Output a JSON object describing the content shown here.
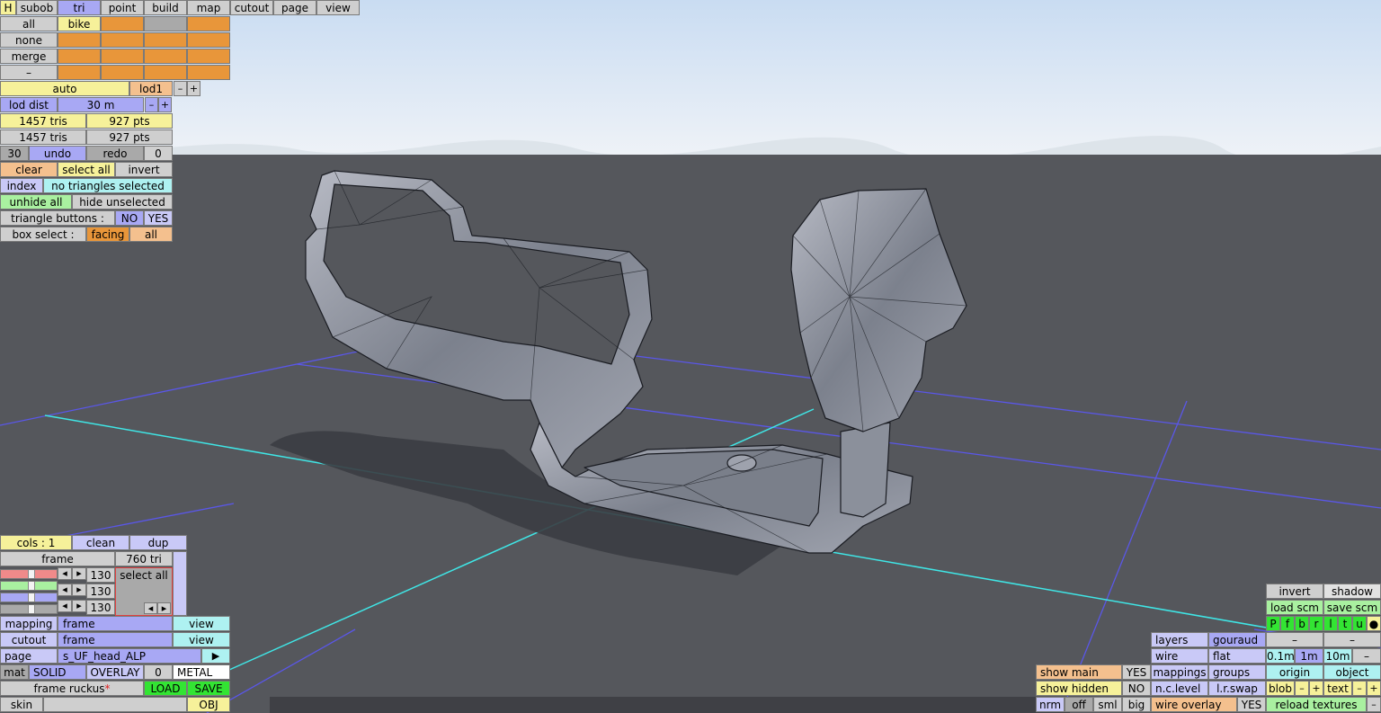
{
  "top_menu": {
    "h": "H",
    "subob": "subob",
    "tri": "tri",
    "point": "point",
    "build": "build",
    "map": "map",
    "cutout": "cutout",
    "page": "page",
    "view": "view"
  },
  "select_panel": {
    "all": "all",
    "none": "none",
    "merge": "merge",
    "dash": "–",
    "object_name": "bike"
  },
  "lod": {
    "auto": "auto",
    "lod1": "lod1",
    "minus": "–",
    "plus": "+",
    "lod_dist_label": "lod dist",
    "lod_dist_value": "30 m"
  },
  "stats": {
    "tris_selected": "1457 tris",
    "pts_selected": "927 pts",
    "tris_total": "1457 tris",
    "pts_total": "927 pts"
  },
  "history": {
    "count": "30",
    "undo": "undo",
    "redo": "redo",
    "redo_count": "0"
  },
  "selection": {
    "clear": "clear",
    "select_all": "select all",
    "invert": "invert",
    "index": "index",
    "status": "no triangles selected",
    "unhide_all": "unhide all",
    "hide_unselected": "hide unselected",
    "triangle_buttons_label": "triangle buttons :",
    "no": "NO",
    "yes": "YES",
    "box_select_label": "box select :",
    "facing": "facing",
    "all": "all"
  },
  "bottom_left": {
    "cols": "cols : 1",
    "clean": "clean",
    "dup": "dup",
    "frame": "frame",
    "frame_tri": "760 tri",
    "r_value": "130",
    "g_value": "130",
    "b_value": "130",
    "select_all": "select all",
    "mapping": "mapping",
    "mapping_value": "frame",
    "mapping_view": "view",
    "cutout": "cutout",
    "cutout_value": "frame",
    "cutout_view": "view",
    "page": "page",
    "page_value": "s_UF_head_ALP",
    "arrow": "▶",
    "mat": "mat",
    "solid": "SOLID",
    "overlay": "OVERLAY",
    "mat_num": "0",
    "metal": "METAL",
    "file_name": "frame ruckus",
    "modified_mark": "*",
    "load": "LOAD",
    "save": "SAVE",
    "skin": "skin",
    "obj": "OBJ"
  },
  "view_panel": {
    "show_main": "show main",
    "show_main_val": "YES",
    "show_hidden": "show hidden",
    "show_hidden_val": "NO",
    "nrm": "nrm",
    "off": "off",
    "sml": "sml",
    "big": "big",
    "layers": "layers",
    "gouraud": "gouraud",
    "wire": "wire",
    "flat": "flat",
    "mappings": "mappings",
    "groups": "groups",
    "nc_level": "n.c.level",
    "lr_swap": "l.r.swap",
    "wire_overlay": "wire overlay",
    "wire_overlay_val": "YES",
    "invert": "invert",
    "shadow": "shadow",
    "load_scm": "load scm",
    "save_scm": "save scm",
    "flags": [
      "P",
      "f",
      "b",
      "r",
      "l",
      "t",
      "u"
    ],
    "dot": "●",
    "dash1": "–",
    "dash2": "–",
    "grid_01": "0.1m",
    "grid_1": "1m",
    "grid_10": "10m",
    "grid_minus": "–",
    "origin": "origin",
    "object": "object",
    "blob": "blob",
    "text": "text",
    "reload_textures": "reload textures",
    "minus": "–",
    "plus": "+"
  },
  "colors": {
    "sky_top": "#cfe2f5",
    "sky_bottom": "#eef3f8",
    "floor": "#55575c",
    "grid_blue": "#5a57e8",
    "grid_cyan": "#3fe6e6",
    "model_fill": "#8e939e",
    "model_edge": "#1a1c22",
    "shadow": "#3b3d42"
  }
}
